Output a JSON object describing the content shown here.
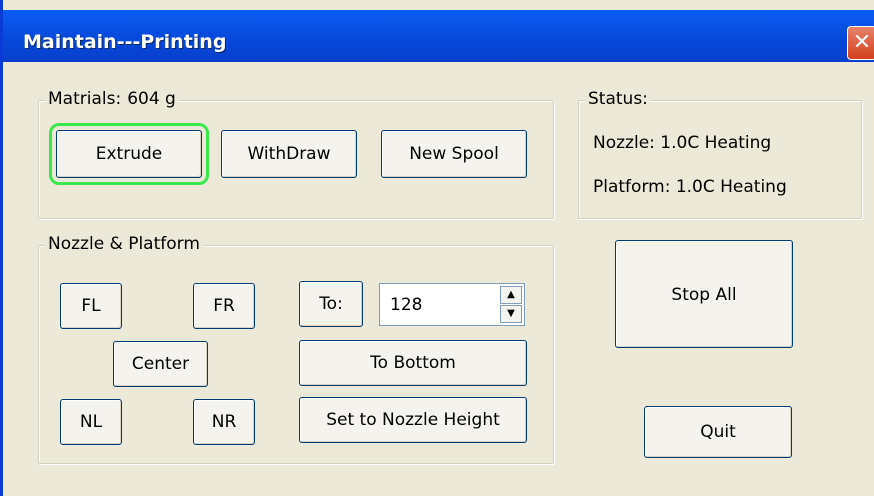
{
  "window": {
    "title": "Maintain---Printing",
    "close_glyph": "✕"
  },
  "materials": {
    "legend": "Matrials:",
    "value": "604 g",
    "buttons": {
      "extrude": "Extrude",
      "withdraw": "WithDraw",
      "new_spool": "New Spool"
    }
  },
  "status": {
    "legend": "Status:",
    "nozzle": "Nozzle: 1.0C Heating",
    "platform": "Platform: 1.0C Heating"
  },
  "nozzle_platform": {
    "legend": "Nozzle & Platform",
    "buttons": {
      "fl": "FL",
      "fr": "FR",
      "center": "Center",
      "nl": "NL",
      "nr": "NR",
      "to": "To:",
      "to_bottom": "To Bottom",
      "set_nozzle_height": "Set to Nozzle Height"
    },
    "height_value": "128",
    "spin_up": "▲",
    "spin_down": "▼"
  },
  "actions": {
    "stop_all": "Stop All",
    "quit": "Quit"
  },
  "colors": {
    "title_bar": "#0a5ff5",
    "focus_highlight": "#39e84a",
    "dialog_bg": "#ece9d8"
  }
}
